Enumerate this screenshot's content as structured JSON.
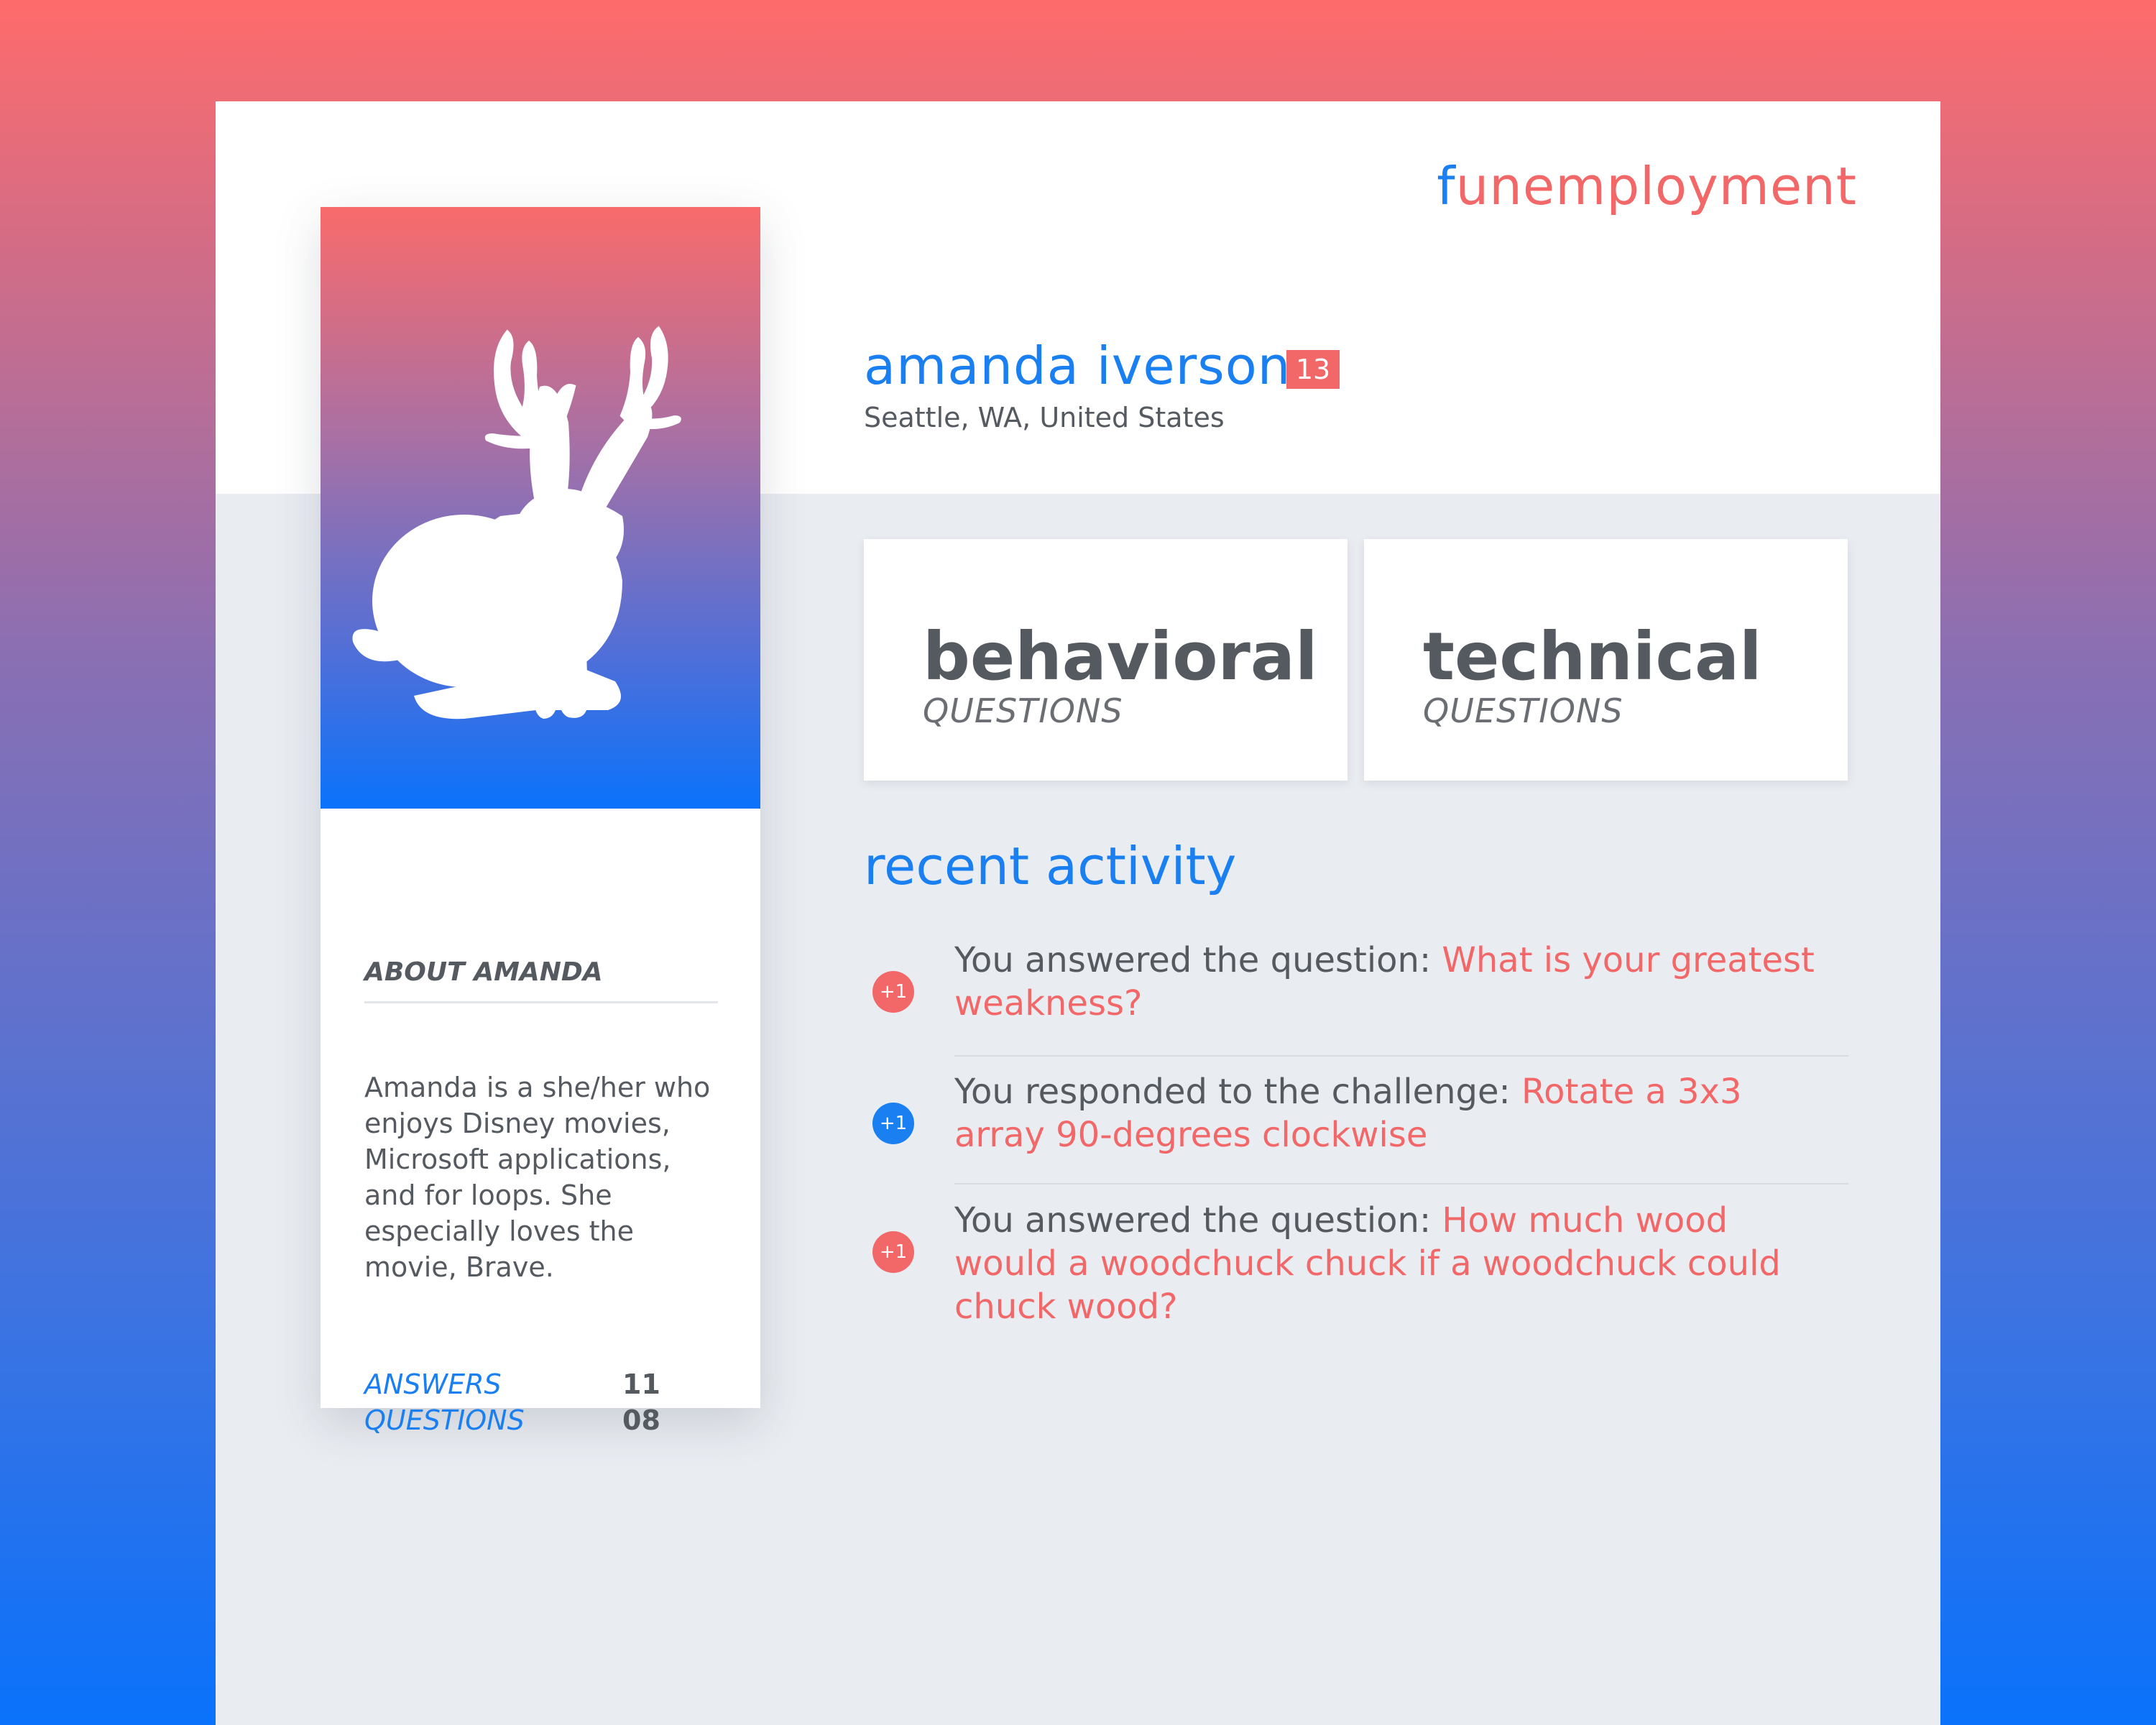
{
  "brand": {
    "first_letter": "f",
    "rest": "unemployment"
  },
  "profile": {
    "name": "amanda iverson",
    "badge": "13",
    "location": "Seattle, WA, United States"
  },
  "about": {
    "title": "ABOUT AMANDA",
    "text": "Amanda is a she/her who enjoys Disney movies, Microsoft applications, and for loops. She especially loves the movie, Brave.",
    "stats": [
      {
        "label": "ANSWERS",
        "value": "11"
      },
      {
        "label": "QUESTIONS",
        "value": "08"
      }
    ]
  },
  "categories": [
    {
      "title": "behavioral",
      "subtitle": "QUESTIONS"
    },
    {
      "title": "technical",
      "subtitle": "QUESTIONS"
    }
  ],
  "activity": {
    "title": "recent activity",
    "items": [
      {
        "badge": "+1",
        "color": "#f26767",
        "prefix": "You answered the question: ",
        "link": "What is your greatest weakness?"
      },
      {
        "badge": "+1",
        "color": "#1a7ff0",
        "prefix": "You responded to the challenge: ",
        "link": "Rotate a 3x3 array 90-degrees clockwise"
      },
      {
        "badge": "+1",
        "color": "#f26767",
        "prefix": "You answered the question: ",
        "link": "How much wood would a woodchuck chuck if a woodchuck could chuck wood?"
      }
    ]
  },
  "icons": {
    "avatar": "jackalope-silhouette-icon"
  },
  "colors": {
    "accent_blue": "#1a7ff0",
    "accent_red": "#f26767",
    "text_gray": "#555a60"
  }
}
